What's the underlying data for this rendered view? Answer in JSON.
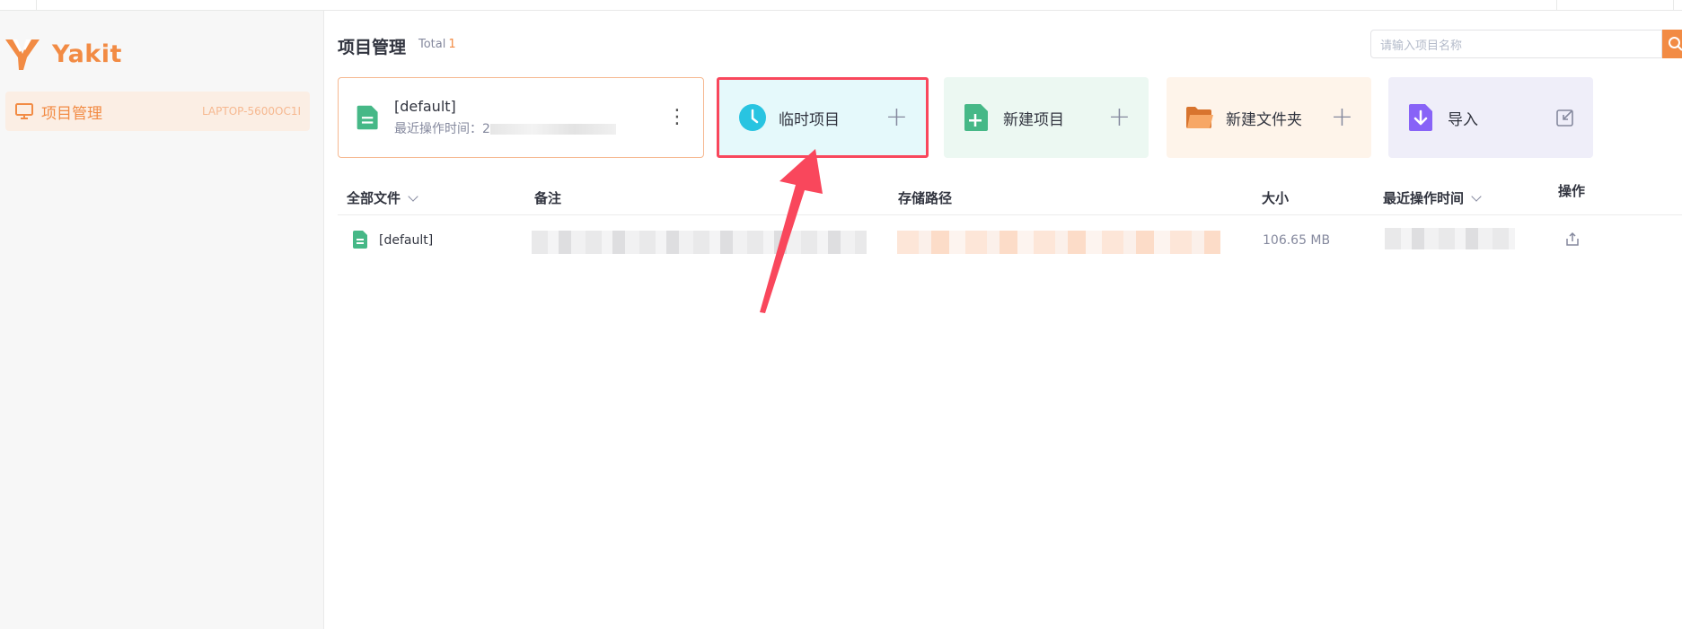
{
  "app": {
    "name": "Yakit"
  },
  "sidebar": {
    "item": {
      "label": "项目管理",
      "host": "LAPTOP-5600OC1I"
    }
  },
  "header": {
    "title": "项目管理",
    "total_label": "Total",
    "total_count": "1",
    "search_placeholder": "请输入项目名称"
  },
  "cards": {
    "default_project": {
      "name": "[default]",
      "time_label": "最近操作时间：2"
    },
    "temp": {
      "label": "临时项目",
      "plus": "+"
    },
    "new_project": {
      "label": "新建项目",
      "plus": "+"
    },
    "new_folder": {
      "label": "新建文件夹",
      "plus": "+"
    },
    "import": {
      "label": "导入"
    }
  },
  "table": {
    "columns": {
      "all_files": "全部文件",
      "remark": "备注",
      "path": "存储路径",
      "size": "大小",
      "last_time": "最近操作时间",
      "action": "操作"
    },
    "rows": [
      {
        "name": "[default]",
        "size": "106.65 MB"
      }
    ]
  },
  "colors": {
    "accent": "#f28b44",
    "highlight_border": "#f9475c",
    "temp_bg": "#e5f9fb",
    "new_bg": "#ecf8f2",
    "folder_bg": "#fef4ea",
    "import_bg": "#efeef9"
  }
}
